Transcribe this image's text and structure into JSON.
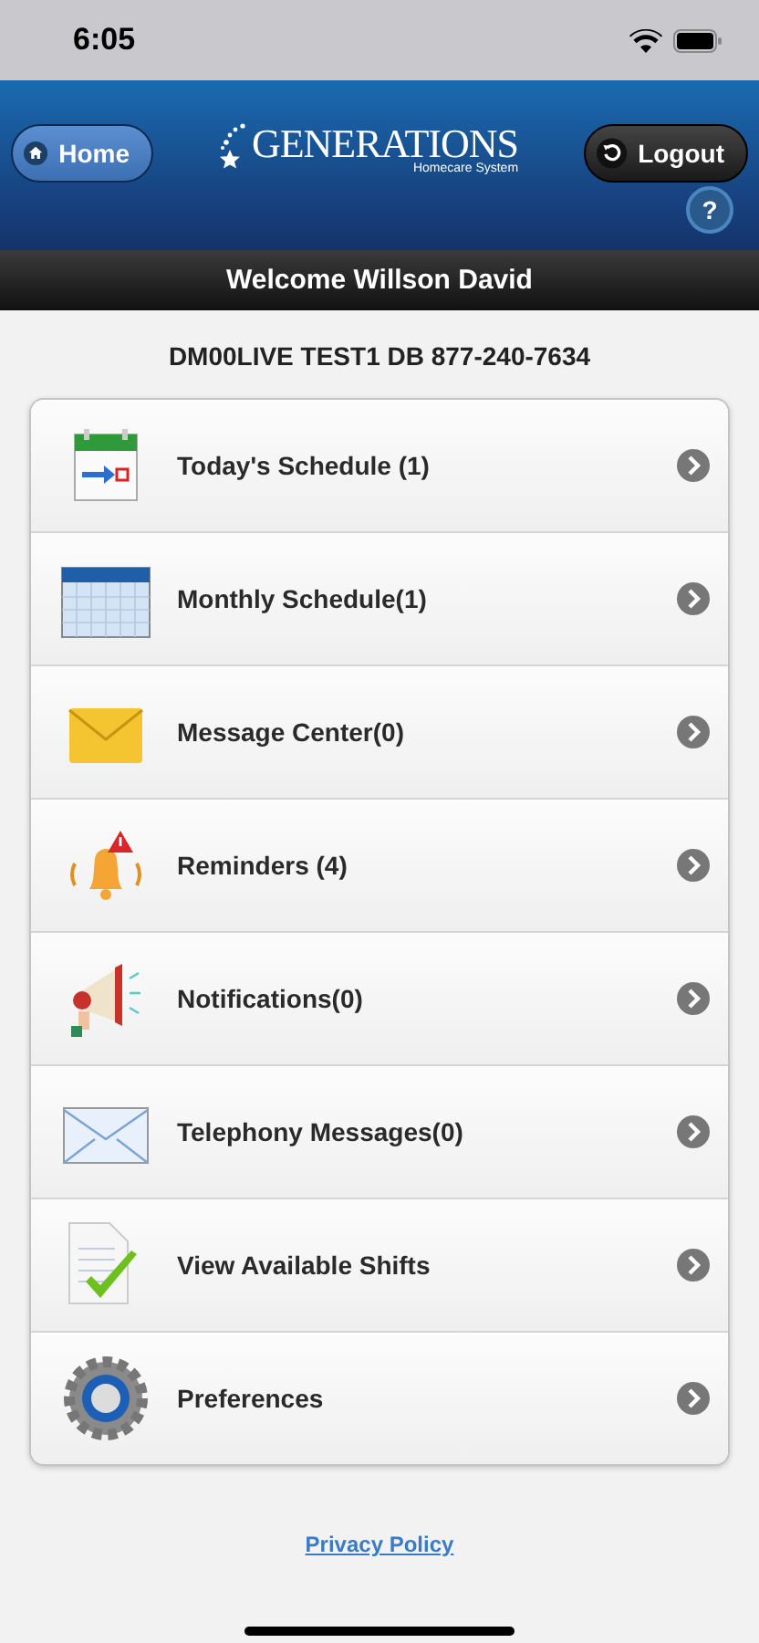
{
  "status_bar": {
    "time": "6:05"
  },
  "header": {
    "home_button": "Home",
    "logo": {
      "name": "GENERATIONS",
      "tagline": "Homecare System"
    },
    "logout_button": "Logout",
    "help_button": "?"
  },
  "welcome": "Welcome Willson David",
  "agency": "DM00LIVE TEST1 DB 877-240-7634",
  "menu": [
    {
      "kind": "today",
      "label": "Today's Schedule (1)"
    },
    {
      "kind": "monthly",
      "label": "Monthly Schedule(1)"
    },
    {
      "kind": "message",
      "label": "Message Center(0)"
    },
    {
      "kind": "reminder",
      "label": "Reminders (4)"
    },
    {
      "kind": "notification",
      "label": "Notifications(0)"
    },
    {
      "kind": "telephony",
      "label": "Telephony Messages(0)"
    },
    {
      "kind": "shifts",
      "label": "View Available Shifts"
    },
    {
      "kind": "preferences",
      "label": "Preferences"
    }
  ],
  "footer_link": "Privacy Policy"
}
